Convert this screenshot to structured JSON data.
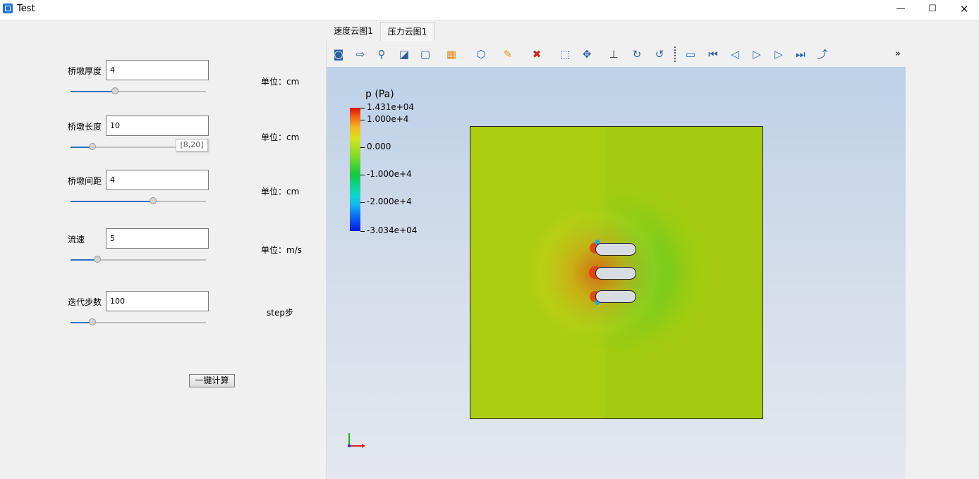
{
  "window": {
    "title": "Test",
    "minimize": "—",
    "maximize": "☐",
    "close": "✕"
  },
  "params": [
    {
      "label": "桥墩厚度",
      "value": "4",
      "unit": "单位：cm",
      "slider_fraction": 0.33
    },
    {
      "label": "桥墩长度",
      "value": "10",
      "unit": "单位：cm",
      "slider_fraction": 0.16
    },
    {
      "label": "桥墩间距",
      "value": "4",
      "unit": "单位：cm",
      "slider_fraction": 0.61
    },
    {
      "label": "流速",
      "value": "5",
      "unit": "单位：m/s",
      "slider_fraction": 0.2
    },
    {
      "label": "迭代步数",
      "value": "100",
      "unit": "step步",
      "slider_fraction": 0.16
    }
  ],
  "tooltip": "[8,20]",
  "calc_button": "一键计算",
  "tabs": [
    "速度云图1",
    "压力云图1"
  ],
  "toolbar": {
    "icons": [
      "camera-icon",
      "export-icon",
      "magic-zoom-icon",
      "reset-view-icon",
      "frame-icon",
      "representation-icon",
      "glyph-icon",
      "clear-icon",
      "ruler-icon",
      "zoom-box-icon",
      "zoom-fit-icon",
      "axes-icon",
      "rotate-cw-icon",
      "rotate-ccw-icon",
      "video-icon",
      "first-frame-icon",
      "prev-frame-icon",
      "play-icon",
      "next-frame-icon",
      "last-frame-icon",
      "loop-icon"
    ],
    "more": "»"
  },
  "legend": {
    "title": "p (Pa)",
    "labels": [
      "1.431e+04",
      "1.000e+4",
      "0.000",
      "-1.000e+4",
      "-2.000e+4",
      "-3.034e+04"
    ],
    "max": 14310,
    "min": -30340,
    "values": [
      14310,
      10000,
      0,
      -10000,
      -20000,
      -30340
    ]
  },
  "colors": {
    "accent": "#2f6fbf",
    "high": "#e0100b",
    "low": "#0a16e6",
    "field_base": "#a3cc10"
  }
}
